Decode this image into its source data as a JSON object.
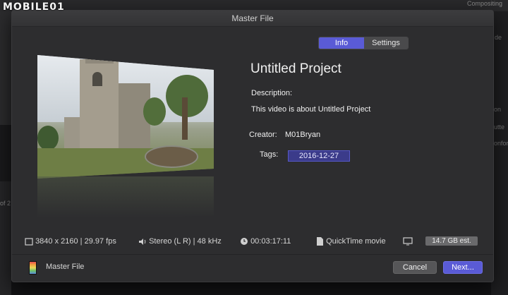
{
  "watermark": "MOBILE01",
  "background": {
    "right_tab": "Compositing",
    "right_texts": [
      "de",
      "on",
      "utte",
      "onfor"
    ],
    "left_text": "of 2"
  },
  "dialog": {
    "title": "Master File",
    "tabs": [
      {
        "label": "Info",
        "active": true
      },
      {
        "label": "Settings",
        "active": false
      }
    ],
    "project_title": "Untitled Project",
    "description_label": "Description:",
    "description_value": "This video is about Untitled Project",
    "creator_label": "Creator:",
    "creator_value": "M01Bryan",
    "tags_label": "Tags:",
    "tags_value": "2016-12-27",
    "specs": {
      "resolution": "3840 x 2160 | 29.97 fps",
      "audio": "Stereo (L R) | 48 kHz",
      "duration": "00:03:17:11",
      "format": "QuickTime movie",
      "size_estimate": "14.7 GB est."
    },
    "footer": {
      "destination_label": "Master File",
      "cancel_label": "Cancel",
      "next_label": "Next..."
    }
  },
  "colors": {
    "accent": "#5a5bd6",
    "sheet_bg": "#2d2d2f"
  }
}
